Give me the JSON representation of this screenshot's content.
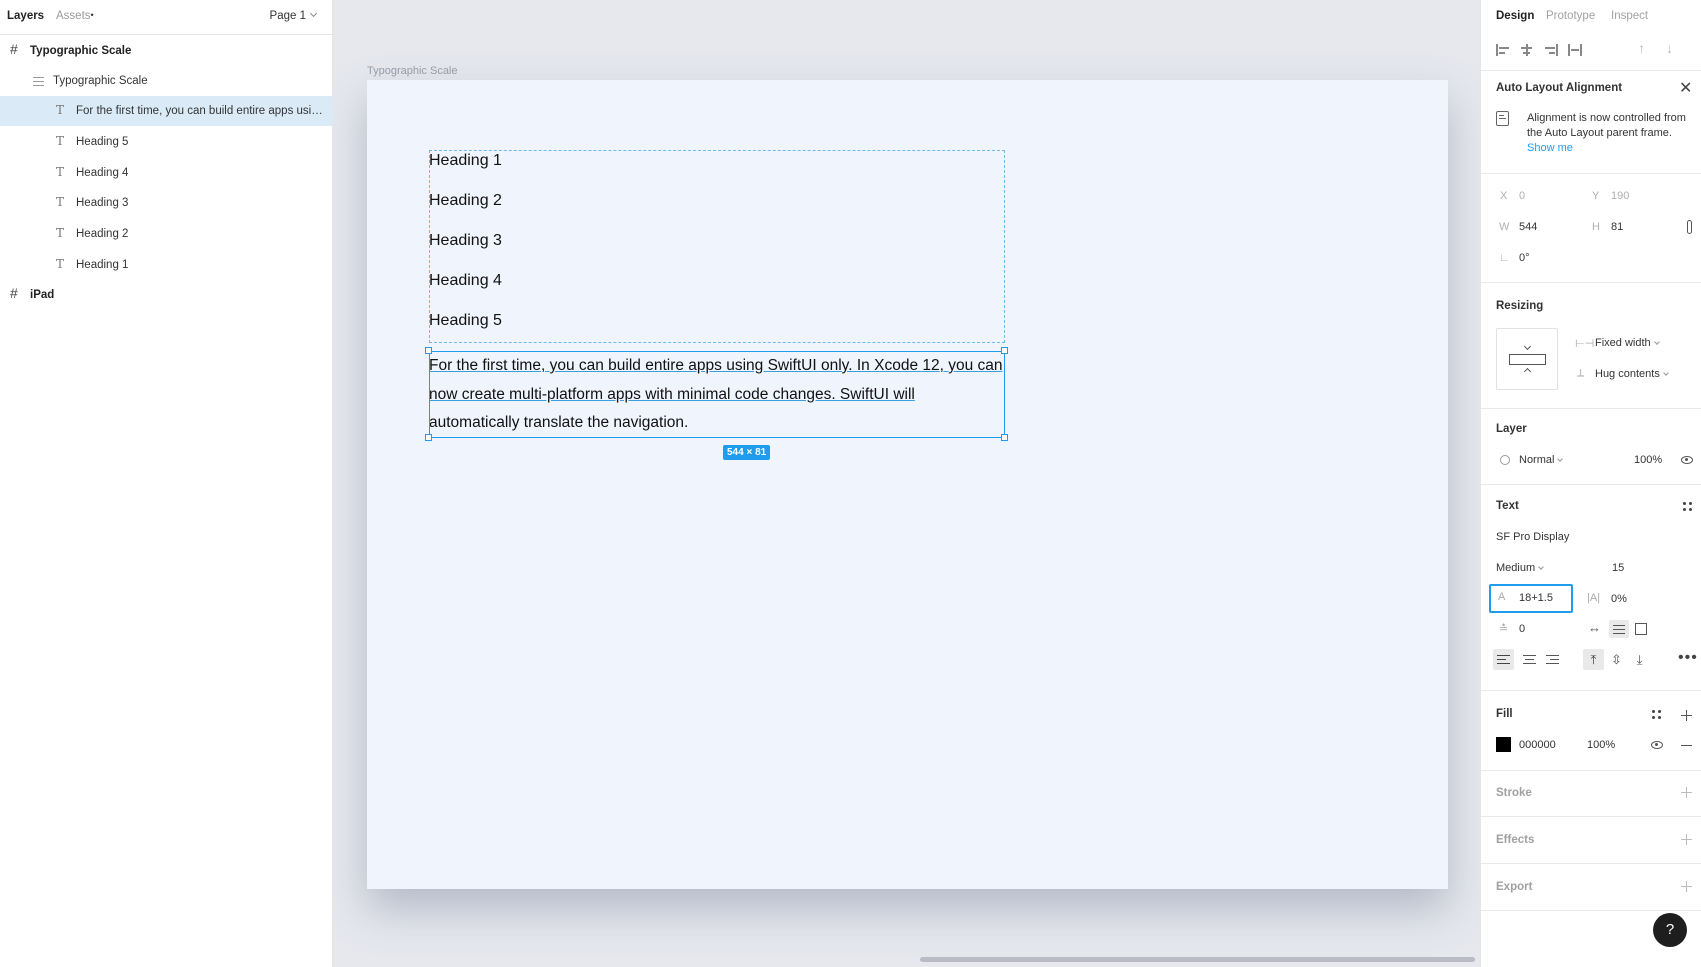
{
  "left_panel": {
    "tabs": {
      "layers": "Layers",
      "assets": "Assets",
      "assets_dot": "•"
    },
    "page_select": "Page 1",
    "layers": [
      {
        "label": "Typographic Scale",
        "icon": "frame-hash-icon"
      },
      {
        "label": "Typographic Scale",
        "icon": "auto-layout-icon"
      },
      {
        "label": "For the first time, you can build entire apps usin...",
        "icon": "text-icon"
      },
      {
        "label": "Heading 5",
        "icon": "text-icon"
      },
      {
        "label": "Heading 4",
        "icon": "text-icon"
      },
      {
        "label": "Heading 3",
        "icon": "text-icon"
      },
      {
        "label": "Heading 2",
        "icon": "text-icon"
      },
      {
        "label": "Heading 1",
        "icon": "text-icon"
      },
      {
        "label": "iPad",
        "icon": "frame-hash-icon"
      }
    ]
  },
  "canvas": {
    "frame_label": "Typographic Scale",
    "headings": [
      "Heading 1",
      "Heading 2",
      "Heading 3",
      "Heading 4",
      "Heading 5"
    ],
    "body_text_line1": "For the first time, you can build entire apps using SwiftUI only. In Xcode 12, you can",
    "body_text_line2": "now create multi-platform apps with minimal code changes. SwiftUI will",
    "body_text_line3": "automatically translate the navigation.",
    "dimension_badge": "544 × 81"
  },
  "right_panel": {
    "tabs": {
      "design": "Design",
      "prototype": "Prototype",
      "inspect": "Inspect"
    },
    "auto_layout": {
      "title": "Auto Layout Alignment",
      "message": "Alignment is now controlled from the Auto Layout parent frame.",
      "link": "Show me"
    },
    "transform": {
      "x_label": "X",
      "x_value": "0",
      "y_label": "Y",
      "y_value": "190",
      "w_label": "W",
      "w_value": "544",
      "h_label": "H",
      "h_value": "81",
      "rotation_label": "∟",
      "rotation_value": "0°"
    },
    "resizing": {
      "title": "Resizing",
      "horizontal": "Fixed width",
      "vertical": "Hug contents"
    },
    "layer": {
      "title": "Layer",
      "blend": "Normal",
      "opacity": "100%"
    },
    "text": {
      "title": "Text",
      "font": "SF Pro Display",
      "weight": "Medium",
      "size": "15",
      "line_height": "18+1.5",
      "letter_spacing": "0%",
      "paragraph_spacing": "0"
    },
    "fill": {
      "title": "Fill",
      "hex": "000000",
      "opacity": "100%",
      "color": "#000000"
    },
    "stroke": {
      "title": "Stroke"
    },
    "effects": {
      "title": "Effects"
    },
    "export": {
      "title": "Export"
    },
    "help": "?"
  }
}
